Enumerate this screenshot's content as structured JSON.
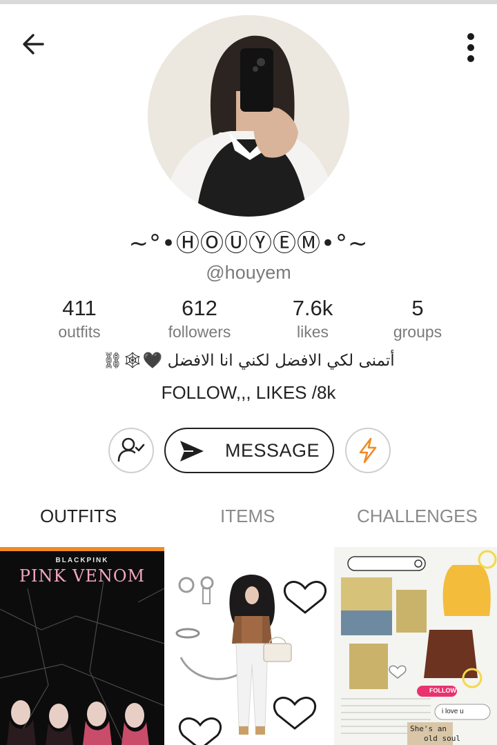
{
  "profile": {
    "display_name": "~°•ⒽⓄⓊⓎⒺⓂ•°~",
    "username": "@houyem",
    "bio_line1": "أتمنى لكي الافضل لكني انا الافضل 🖤🕸⛓",
    "bio_line2": "FOLLOW,,, LIKES /8k"
  },
  "stats": [
    {
      "value": "411",
      "label": "outfits"
    },
    {
      "value": "612",
      "label": "followers"
    },
    {
      "value": "7.6k",
      "label": "likes"
    },
    {
      "value": "5",
      "label": "groups"
    }
  ],
  "actions": {
    "message_label": "MESSAGE"
  },
  "tabs": [
    {
      "label": "OUTFITS"
    },
    {
      "label": "ITEMS"
    },
    {
      "label": "CHALLENGES"
    }
  ],
  "grid": {
    "item1": {
      "brand": "BLACKPINK",
      "title": "PINK VENOM"
    },
    "item3": {
      "follow_tag": "FOLLOW",
      "note_text": "i love u",
      "caption_line1": "She's an",
      "caption_line2": "old soul"
    }
  },
  "colors": {
    "accent_orange": "#f08a24",
    "verified_blue": "#1a73e8",
    "follow_pink": "#e8336f"
  }
}
